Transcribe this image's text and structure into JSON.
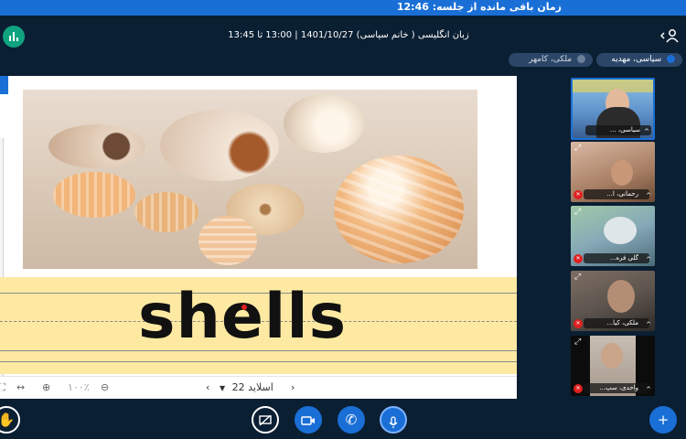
{
  "timer": {
    "text": "زمان باقی مانده از جلسه: 12:46"
  },
  "header": {
    "title": "زبان انگلیسی ( خانم سیاسی) 1401/10/27 | 13:00 تا 13:45",
    "pills": [
      {
        "label": "سیاسی، مهدیه"
      },
      {
        "label": "ملکی، کامهر"
      }
    ]
  },
  "presentation": {
    "word": "shells",
    "zoom": "۱۰۰٪",
    "slide_label": "اسلاید 22"
  },
  "webcams": [
    {
      "label": "سیاسی، ..."
    },
    {
      "label": "رحمانی، ا..."
    },
    {
      "label": "گلی فره..."
    },
    {
      "label": "ملکی، کیا..."
    },
    {
      "label": "واحدی، سپ..."
    }
  ],
  "colors": {
    "accent": "#1a6fd6",
    "background": "#0b1f33",
    "logo": "#0fa37f",
    "band": "#fde9a2",
    "danger": "#e02020"
  },
  "icons": {
    "logo": "bigbluebutton-logo-icon",
    "users": "users-toggle-icon",
    "raise_hand": "raise-hand-icon",
    "screen_share": "screen-share-icon",
    "camera": "camera-icon",
    "phone": "phone-icon",
    "mic": "microphone-icon",
    "plus": "plus-icon"
  }
}
